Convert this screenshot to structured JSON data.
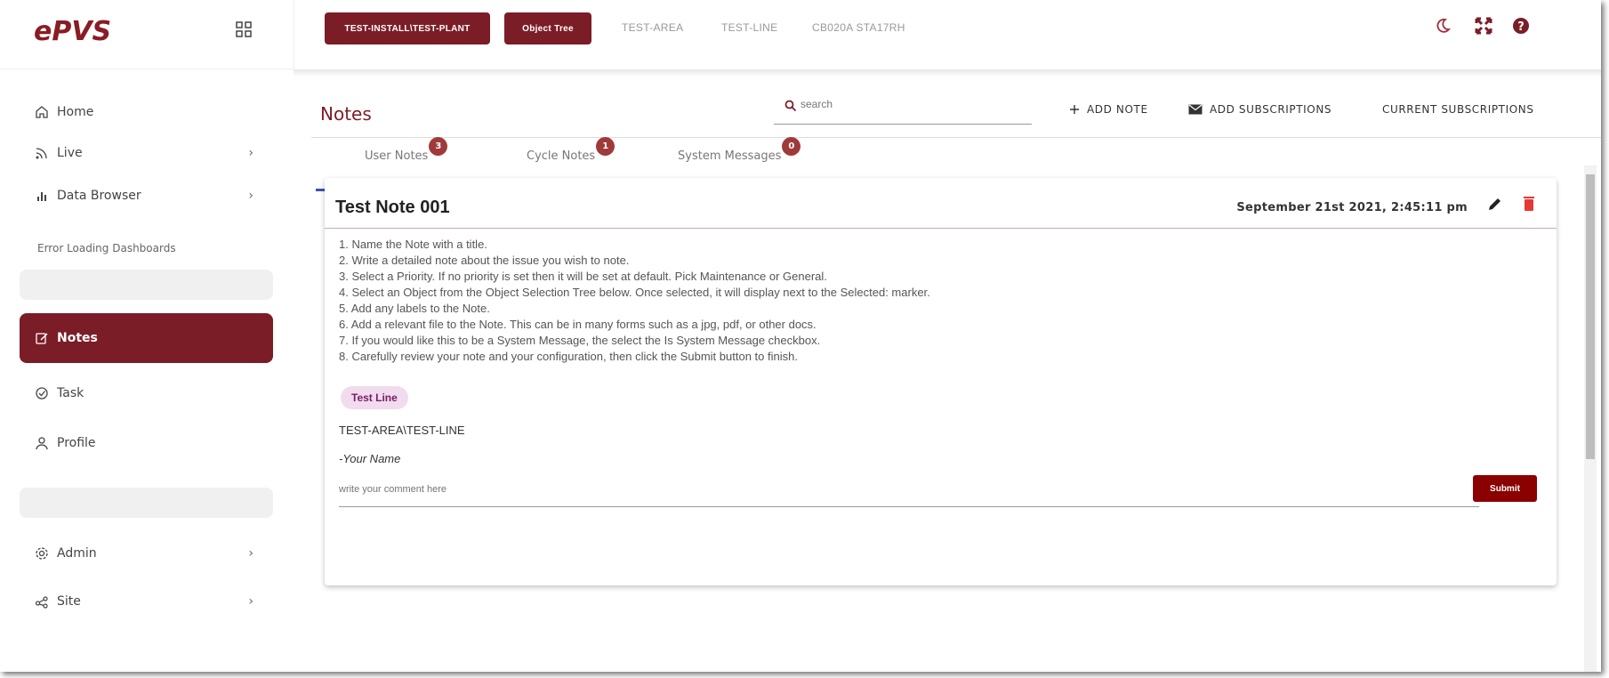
{
  "brand": {
    "logo_text": "ePVS"
  },
  "sidebar": {
    "items": [
      {
        "label": "Home",
        "icon": "home-icon"
      },
      {
        "label": "Live",
        "icon": "live-icon"
      },
      {
        "label": "Data Browser",
        "icon": "bar-chart-icon"
      },
      {
        "label": "Notes",
        "icon": "note-edit-icon"
      },
      {
        "label": "Task",
        "icon": "task-check-icon"
      },
      {
        "label": "Profile",
        "icon": "person-icon"
      },
      {
        "label": "Admin",
        "icon": "gear-icon"
      },
      {
        "label": "Site",
        "icon": "share-icon"
      }
    ],
    "error_text": "Error Loading Dashboards"
  },
  "topbar": {
    "crumb_primary": "TEST-INSTALL\\TEST-PLANT",
    "crumb_object_tree": "Object Tree",
    "crumb_area": "TEST-AREA",
    "crumb_line": "TEST-LINE",
    "crumb_station": "CB020A STA17RH"
  },
  "colors": {
    "accent": "#7b1d27",
    "badge": "#a03a3a",
    "tab_underline": "#3f51b5",
    "danger": "#e53935"
  },
  "notes_page": {
    "title": "Notes",
    "search_placeholder": "search",
    "add_note_label": "ADD NOTE",
    "add_subscriptions_label": "ADD SUBSCRIPTIONS",
    "current_subscriptions_label": "CURRENT SUBSCRIPTIONS",
    "tabs": [
      {
        "label": "User Notes",
        "count": "3"
      },
      {
        "label": "Cycle Notes",
        "count": "1"
      },
      {
        "label": "System Messages",
        "count": "0"
      }
    ]
  },
  "note": {
    "title": "Test Note 001",
    "date": "September 21st 2021, 2:45:11 pm",
    "lines": [
      "1. Name the Note with a title.",
      "2. Write a detailed note about the issue you wish to note.",
      "3. Select a Priority. If no priority is set then it will be set at default. Pick Maintenance or General.",
      "4. Select an Object from the Object Selection Tree below. Once selected, it will display next to the Selected: marker.",
      "5. Add any labels to the Note.",
      "6. Add a relevant file to the Note. This can be in many forms such as a jpg, pdf, or other docs.",
      "7. If you would like this to be a System Message, the select the Is System Message checkbox.",
      "8. Carefully review your note and your configuration, then click the Submit button to finish."
    ],
    "chip_label": "Test Line",
    "object_path": "TEST-AREA\\TEST-LINE",
    "signature": "-Your Name",
    "comment_placeholder": "write your comment here",
    "submit_label": "Submit"
  }
}
